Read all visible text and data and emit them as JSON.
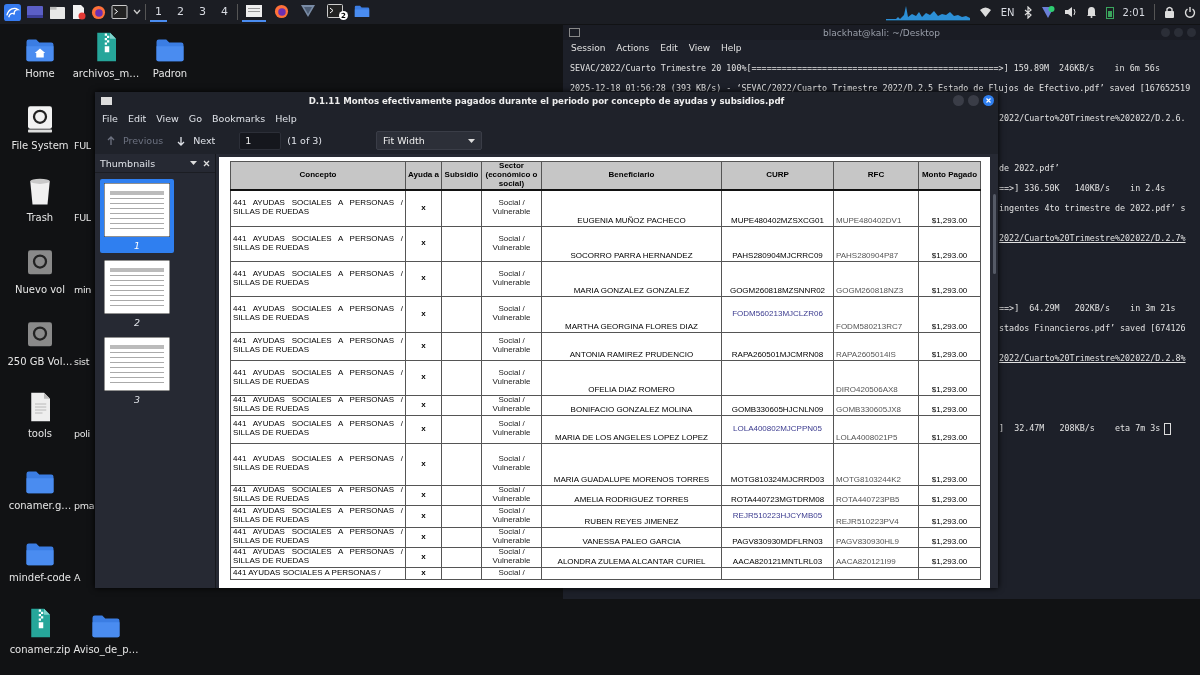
{
  "taskbar": {
    "workspaces": [
      {
        "label": "1",
        "selected": true
      },
      {
        "label": "2",
        "selected": false
      },
      {
        "label": "3",
        "selected": false
      },
      {
        "label": "4",
        "selected": false
      }
    ],
    "tasks": [
      {
        "kind": "viewer",
        "selected": true
      },
      {
        "kind": "browser",
        "selected": false
      },
      {
        "kind": "vpn",
        "selected": false
      },
      {
        "kind": "terminal",
        "selected": false,
        "badge": "2"
      },
      {
        "kind": "folder",
        "selected": false
      }
    ],
    "keyboard_layout": "EN",
    "clock": "2:01"
  },
  "desktop_icons": [
    {
      "label": "Home",
      "kind": "home"
    },
    {
      "label": "File System",
      "kind": "drive"
    },
    {
      "label": "Trash",
      "kind": "trash"
    },
    {
      "label": "Nuevo vol",
      "kind": "disk"
    },
    {
      "label": "250 GB Vol…",
      "kind": "disk"
    },
    {
      "label": "tools",
      "kind": "document"
    },
    {
      "label": "conamer.g…",
      "kind": "folder"
    },
    {
      "label": "mindef-code",
      "kind": "folder"
    },
    {
      "label": "conamer.zip",
      "kind": "archive"
    },
    {
      "label": "archivos_m…",
      "kind": "archive"
    },
    {
      "label": "FUL",
      "kind": "covered"
    },
    {
      "label": "FUL",
      "kind": "covered"
    },
    {
      "label": "min",
      "kind": "covered"
    },
    {
      "label": "sist",
      "kind": "covered"
    },
    {
      "label": "poli",
      "kind": "covered"
    },
    {
      "label": "pma",
      "kind": "covered"
    },
    {
      "label": "A",
      "kind": "covered"
    },
    {
      "label": "Aviso_de_p…",
      "kind": "folder"
    },
    {
      "label": "Padron",
      "kind": "folder"
    }
  ],
  "terminal": {
    "title": "blackhat@kali: ~/Desktop",
    "menu": [
      "Session",
      "Actions",
      "Edit",
      "View",
      "Help"
    ],
    "lines": [
      {
        "text": "SEVAC/2022/Cuarto Trimestre 20 100%[=================================================>] 159.89M  246KB/s    in 6m 56s",
        "kind": "full"
      },
      {
        "text": "2025-12-18 01:56:28 (393 KB/s) - ‘SEVAC/2022/Cuarto Trimestre 2022/D.2.5 Estado de Flujos de Efectivo.pdf’ saved [167652519",
        "kind": "full"
      },
      {
        "text": "2022/Cuarto%20Trimestre%202022/D.2.6.",
        "kind": "clipped"
      },
      {
        "text": "de 2022.pdf’",
        "kind": "clipped"
      },
      {
        "text": "==>] 336.50K   140KB/s    in 2.4s",
        "kind": "clipped"
      },
      {
        "text": "ingentes 4to trimestre de 2022.pdf’ s",
        "kind": "clipped"
      },
      {
        "text": "2022/Cuarto%20Trimestre%202022/D.2.7%",
        "kind": "link"
      },
      {
        "text": "==>]  64.29M   202KB/s    in 3m 21s",
        "kind": "clipped"
      },
      {
        "text": "stados Financieros.pdf’ saved [674126",
        "kind": "clipped"
      },
      {
        "text": "2022/Cuarto%20Trimestre%202022/D.2.8%",
        "kind": "link"
      },
      {
        "text": "]  32.47M   208KB/s    eta 7m 3s",
        "kind": "clipped"
      }
    ]
  },
  "pdf_viewer": {
    "title": "D.1.11 Montos efectivamente pagados durante el periodo por concepto de ayudas y subsidios.pdf",
    "menu": [
      "File",
      "Edit",
      "View",
      "Go",
      "Bookmarks",
      "Help"
    ],
    "toolbar": {
      "previous": {
        "label": "Previous",
        "disabled": true
      },
      "next": {
        "label": "Next",
        "disabled": false
      },
      "page": "1",
      "page_count": "(1 of 3)",
      "zoom": "Fit Width"
    },
    "sidebar": {
      "title": "Thumbnails",
      "thumbnails": [
        {
          "label": "1",
          "selected": true
        },
        {
          "label": "2",
          "selected": false
        },
        {
          "label": "3",
          "selected": false
        }
      ]
    },
    "table": {
      "columns": [
        "Concepto",
        "Ayuda a",
        "Subsidio",
        "Sector (económico o social)",
        "Beneficiario",
        "CURP",
        "RFC",
        "Monto Pagado"
      ],
      "rows": [
        {
          "concepto": "441 AYUDAS SOCIALES A PERSONAS / SILLAS DE RUEDAS",
          "ayuda": "x",
          "sector": "Social / Vulnerable",
          "beneficiario": "EUGENIA MUÑOZ PACHECO",
          "curp": "MUPE480402MZSXCG01",
          "curp_highlighted": false,
          "rfc": "MUPE480402DV1",
          "monto": "$1,293.00"
        },
        {
          "concepto": "441 AYUDAS SOCIALES A PERSONAS / SILLAS DE RUEDAS",
          "ayuda": "x",
          "sector": "Social / Vulnerable",
          "beneficiario": "SOCORRO PARRA HERNANDEZ",
          "curp": "PAHS280904MJCRRC09",
          "curp_highlighted": false,
          "rfc": "PAHS280904P87",
          "monto": "$1,293.00"
        },
        {
          "concepto": "441 AYUDAS SOCIALES A PERSONAS / SILLAS DE RUEDAS",
          "ayuda": "x",
          "sector": "Social / Vulnerable",
          "beneficiario": "MARIA GONZALEZ GONZALEZ",
          "curp": "GOGM260818MZSNNR02",
          "curp_highlighted": false,
          "rfc": "GOGM260818NZ3",
          "monto": "$1,293.00"
        },
        {
          "concepto": "441 AYUDAS SOCIALES A PERSONAS / SILLAS DE RUEDAS",
          "ayuda": "x",
          "sector": "Social / Vulnerable",
          "beneficiario": "MARTHA GEORGINA FLORES DIAZ",
          "curp": "FODM560213MJCLZR06",
          "curp_highlighted": true,
          "rfc": "FODM580213RC7",
          "monto": "$1,293.00"
        },
        {
          "concepto": "441 AYUDAS SOCIALES A PERSONAS / SILLAS DE RUEDAS",
          "ayuda": "x",
          "sector": "Social / Vulnerable",
          "beneficiario": "ANTONIA RAMIREZ PRUDENCIO",
          "curp": "RAPA260501MJCMRN08",
          "curp_highlighted": false,
          "rfc": "RAPA2605014IS",
          "monto": "$1,293.00"
        },
        {
          "concepto": "441 AYUDAS SOCIALES A PERSONAS / SILLAS DE RUEDAS",
          "ayuda": "x",
          "sector": "Social / Vulnerable",
          "beneficiario": "OFELIA DIAZ ROMERO",
          "rfc": "DIRO420506AX8",
          "monto": "$1,293.00"
        },
        {
          "concepto": "441 AYUDAS SOCIALES A PERSONAS / SILLAS DE RUEDAS",
          "ayuda": "x",
          "sector": "Social / Vulnerable",
          "beneficiario": "BONIFACIO GONZALEZ MOLINA",
          "curp": "GOMB330605HJCNLN09",
          "curp_highlighted": false,
          "rfc": "GOMB330605JX8",
          "monto": "$1,293.00"
        },
        {
          "concepto": "441 AYUDAS SOCIALES A PERSONAS / SILLAS DE RUEDAS",
          "ayuda": "x",
          "sector": "Social / Vulnerable",
          "beneficiario": "MARIA DE LOS ANGELES LOPEZ LOPEZ",
          "curp": "LOLA400802MJCPPN05",
          "curp_highlighted": true,
          "rfc": "LOLA4008021P5",
          "monto": "$1,293.00"
        },
        {
          "concepto": "441 AYUDAS SOCIALES A PERSONAS / SILLAS DE RUEDAS",
          "ayuda": "x",
          "sector": "Social / Vulnerable",
          "beneficiario": "MARIA GUADALUPE MORENOS TORRES",
          "curp": "MOTG810324MJCRRD03",
          "curp_highlighted": false,
          "rfc": "MOTG8103244K2",
          "monto": "$1,293.00"
        },
        {
          "concepto": "441 AYUDAS SOCIALES A PERSONAS / SILLAS DE RUEDAS",
          "ayuda": "x",
          "sector": "Social / Vulnerable",
          "beneficiario": "AMELIA RODRIGUEZ TORRES",
          "curp": "ROTA440723MGTDRM08",
          "curp_highlighted": false,
          "rfc": "ROTA440723PB5",
          "monto": "$1,293.00"
        },
        {
          "concepto": "441 AYUDAS SOCIALES A PERSONAS / SILLAS DE RUEDAS",
          "ayuda": "x",
          "sector": "Social / Vulnerable",
          "beneficiario": "RUBEN REYES JIMENEZ",
          "curp": "REJR510223HJCYMB05",
          "curp_highlighted": true,
          "rfc": "REJR510223PV4",
          "monto": "$1,293.00"
        },
        {
          "concepto": "441 AYUDAS SOCIALES A PERSONAS / SILLAS DE RUEDAS",
          "ayuda": "x",
          "sector": "Social / Vulnerable",
          "beneficiario": "VANESSA PALEO GARCIA",
          "curp": "PAGV830930MDFLRN03",
          "curp_highlighted": false,
          "rfc": "PAGV830930HL9",
          "monto": "$1,293.00"
        },
        {
          "concepto": "441 AYUDAS SOCIALES A PERSONAS / SILLAS DE RUEDAS",
          "ayuda": "x",
          "sector": "Social / Vulnerable",
          "beneficiario": "ALONDRA ZULEMA ALCANTAR CURIEL",
          "curp": "AACA820121MNTLRL03",
          "curp_highlighted": false,
          "rfc": "AACA820121I99",
          "monto": "$1,293.00"
        },
        {
          "concepto": "441 AYUDAS SOCIALES A PERSONAS /",
          "ayuda": "x",
          "sector": "Social /"
        }
      ]
    }
  }
}
